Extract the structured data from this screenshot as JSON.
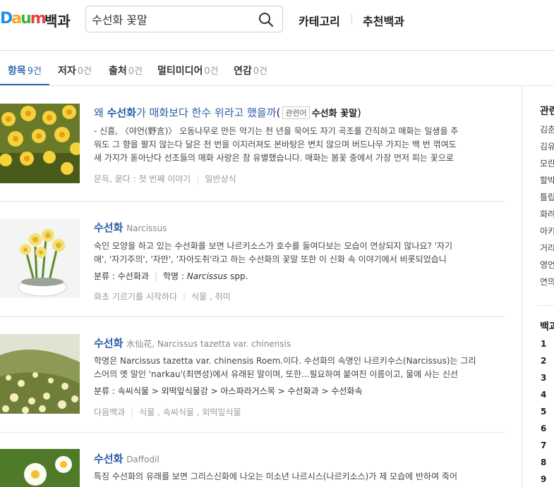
{
  "header": {
    "logo_parts": [
      "D",
      "a",
      "u",
      "m"
    ],
    "service": "백과",
    "search_value": "수선화 꽃말",
    "nav": [
      "카테고리",
      "추천백과"
    ]
  },
  "tabs": [
    {
      "label": "항목",
      "count": "9건"
    },
    {
      "label": "저자",
      "count": "0건"
    },
    {
      "label": "출처",
      "count": "0건"
    },
    {
      "label": "멀티미디어",
      "count": "0건"
    },
    {
      "label": "연감",
      "count": "0건"
    }
  ],
  "results": [
    {
      "title_pre": "왜 ",
      "title_bold": "수선화",
      "title_post": "가 매화보다 한수 위라고 했을까",
      "tag": "관련어",
      "related": "수선화 꽃말",
      "desc_line1": "- 신흠, 〈야언(野言)〉 오동나무로 만든 악기는 천 년을 묵어도 자기 곡조를 간직하고 매화는 일생을 추",
      "desc_line2": "워도 그 향을 팔지 않는다 달은 천 번을 이지러져도 본바탕은 변치 않으며 버드나무 가지는 백 번 꺾여도",
      "desc_line3": "새 가지가 돋아난다 선조들의 매화 사랑은 참 유별했습니다. 매화는 봄꽃 중에서 가장 먼저 피는 꽃으로",
      "source": "문득, 묻다 : 첫 번째 이야기",
      "category": "일반상식"
    },
    {
      "title": "수선화",
      "sub": "Narcissus",
      "desc_line1": "숙인 모양을 하고 있는 수선화를 보면 나르키소스가 호수를 들여다보는 모습이 연상되지 않나요? '자기",
      "desc_line2": "애', '자기주의', '자만', '자아도취'라고 하는 수선화의 꽃말 또한 이 신화 속 이야기에서 비롯되었습니",
      "meta_class": "분류 : 수선화과",
      "meta_name_label": "학명 : ",
      "meta_name": "Narcissus",
      "meta_name_suffix": " spp.",
      "source": "화초 기르기를 시작하다",
      "category": "식물 , 취미"
    },
    {
      "title": "수선화",
      "sub": "水仙花, Narcissus tazetta var. chinensis",
      "desc_line1": "학명은 Narcissus tazetta var. chinensis Roem.이다. 수선화의 속명인 나르키수스(Narcissus)는 그리",
      "desc_line2": "스어의 옛 말인 'narkau'(최면성)에서 유래된 말이며, 또한...필요하여 붙여진 이름이고, 물에 사는 신선",
      "meta_class": "분류 : 속씨식물 > 외떡잎식물강 > 아스파라거스목 > 수선화과 > 수선화속",
      "source": "다음백과",
      "category": "식물 , 속씨식물 , 외떡잎식물"
    },
    {
      "title": "수선화",
      "sub": "Daffodil",
      "desc_line1": "특징 수선화의 유래를 보면 그리스신화에 나오는 미소년 나르시스(나르키소스)가 제 모습에 반하여 죽어"
    }
  ],
  "right": {
    "related_head": "관련",
    "related_items": [
      "김춘",
      "김유",
      "모란",
      "할박",
      "틀립",
      "화려",
      "아키",
      "거리",
      "영언",
      "연의"
    ],
    "rank_head": "백과",
    "ranks": [
      "1",
      "2",
      "3",
      "4",
      "5",
      "6",
      "7",
      "8",
      "9"
    ]
  }
}
